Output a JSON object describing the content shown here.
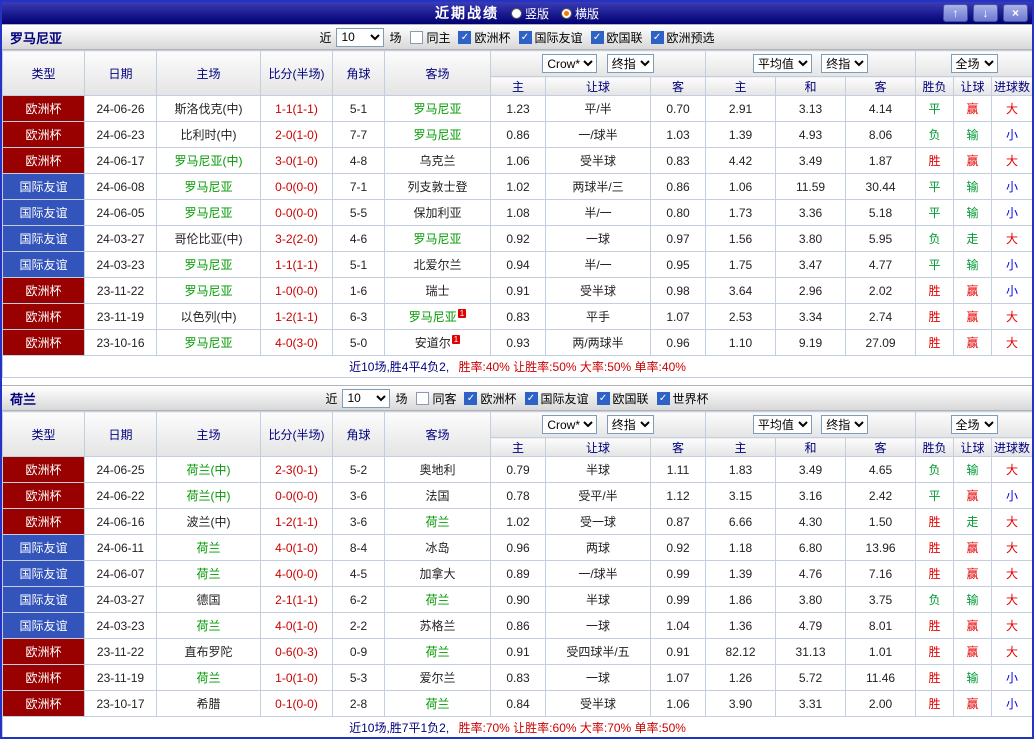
{
  "titlebar": {
    "title": "近期战绩",
    "options": [
      {
        "label": "竖版",
        "selected": false
      },
      {
        "label": "横版",
        "selected": true
      }
    ],
    "buttons": {
      "up": "↑",
      "down": "↓",
      "close": "×"
    }
  },
  "ui": {
    "recent_prefix": "近",
    "recent_suffix": "场",
    "cols": [
      "类型",
      "日期",
      "主场",
      "比分(半场)",
      "角球",
      "客场"
    ],
    "sub": [
      "主",
      "让球",
      "客",
      "主",
      "和",
      "客",
      "胜负",
      "让球",
      "进球数"
    ],
    "dd": {
      "source": "Crow*",
      "period": "终指",
      "average": "平均值",
      "period2": "终指",
      "scope": "全场"
    }
  },
  "palette": {
    "css": {
      "frame": "#2334c4",
      "tb1": "#3b3bb5",
      "tb2": "#000072",
      "navy": "#00007d",
      "line": "#c3cfe1",
      "headbg1": "#fcfcfc",
      "headbg2": "#e4e4e4",
      "barbg1": "#ffffff",
      "barbg2": "#d8d8d8",
      "btn1": "#a9b3ea",
      "btn2": "#6b79d2",
      "radio_dot": "#ff7700",
      "check": "#2f62c6",
      "score": "#cc0000"
    },
    "type_colors": {
      "欧洲杯": "#990000",
      "国际友谊": "#3355bb"
    },
    "focus_team": "#009900",
    "score": "#cc0000",
    "result": {
      "r": "#e60000",
      "g": "#009933",
      "b": "#0000ee"
    }
  },
  "sections": [
    {
      "team": "罗马尼亚",
      "filter": {
        "count": "10",
        "checkboxes": [
          {
            "label": "同主",
            "checked": false
          },
          {
            "label": "欧洲杯",
            "checked": true
          },
          {
            "label": "国际友谊",
            "checked": true
          },
          {
            "label": "欧国联",
            "checked": true
          },
          {
            "label": "欧洲预选",
            "checked": true
          }
        ]
      },
      "rows": [
        {
          "type": "欧洲杯",
          "date": "24-06-26",
          "home": {
            "n": "斯洛伐克(中)",
            "f": false
          },
          "score": "1-1(1-1)",
          "cor": "5-1",
          "away": {
            "n": "罗马尼亚",
            "f": true
          },
          "odds": [
            "1.23",
            "平/半",
            "0.70",
            "2.91",
            "3.13",
            "4.14"
          ],
          "res": [
            [
              "平",
              "g"
            ],
            [
              "赢",
              "r"
            ],
            [
              "大",
              "r"
            ]
          ]
        },
        {
          "type": "欧洲杯",
          "date": "24-06-23",
          "home": {
            "n": "比利时(中)",
            "f": false
          },
          "score": "2-0(1-0)",
          "cor": "7-7",
          "away": {
            "n": "罗马尼亚",
            "f": true
          },
          "odds": [
            "0.86",
            "一/球半",
            "1.03",
            "1.39",
            "4.93",
            "8.06"
          ],
          "res": [
            [
              "负",
              "g"
            ],
            [
              "输",
              "g"
            ],
            [
              "小",
              "b"
            ]
          ]
        },
        {
          "type": "欧洲杯",
          "date": "24-06-17",
          "home": {
            "n": "罗马尼亚(中)",
            "f": true
          },
          "score": "3-0(1-0)",
          "cor": "4-8",
          "away": {
            "n": "乌克兰",
            "f": false
          },
          "odds": [
            "1.06",
            "受半球",
            "0.83",
            "4.42",
            "3.49",
            "1.87"
          ],
          "res": [
            [
              "胜",
              "r"
            ],
            [
              "赢",
              "r"
            ],
            [
              "大",
              "r"
            ]
          ]
        },
        {
          "type": "国际友谊",
          "date": "24-06-08",
          "home": {
            "n": "罗马尼亚",
            "f": true
          },
          "score": "0-0(0-0)",
          "cor": "7-1",
          "away": {
            "n": "列支敦士登",
            "f": false
          },
          "odds": [
            "1.02",
            "两球半/三",
            "0.86",
            "1.06",
            "11.59",
            "30.44"
          ],
          "res": [
            [
              "平",
              "g"
            ],
            [
              "输",
              "g"
            ],
            [
              "小",
              "b"
            ]
          ]
        },
        {
          "type": "国际友谊",
          "date": "24-06-05",
          "home": {
            "n": "罗马尼亚",
            "f": true
          },
          "score": "0-0(0-0)",
          "cor": "5-5",
          "away": {
            "n": "保加利亚",
            "f": false
          },
          "odds": [
            "1.08",
            "半/一",
            "0.80",
            "1.73",
            "3.36",
            "5.18"
          ],
          "res": [
            [
              "平",
              "g"
            ],
            [
              "输",
              "g"
            ],
            [
              "小",
              "b"
            ]
          ]
        },
        {
          "type": "国际友谊",
          "date": "24-03-27",
          "home": {
            "n": "哥伦比亚(中)",
            "f": false
          },
          "score": "3-2(2-0)",
          "cor": "4-6",
          "away": {
            "n": "罗马尼亚",
            "f": true
          },
          "odds": [
            "0.92",
            "一球",
            "0.97",
            "1.56",
            "3.80",
            "5.95"
          ],
          "res": [
            [
              "负",
              "g"
            ],
            [
              "走",
              "g"
            ],
            [
              "大",
              "r"
            ]
          ]
        },
        {
          "type": "国际友谊",
          "date": "24-03-23",
          "home": {
            "n": "罗马尼亚",
            "f": true
          },
          "score": "1-1(1-1)",
          "cor": "5-1",
          "away": {
            "n": "北爱尔兰",
            "f": false
          },
          "odds": [
            "0.94",
            "半/一",
            "0.95",
            "1.75",
            "3.47",
            "4.77"
          ],
          "res": [
            [
              "平",
              "g"
            ],
            [
              "输",
              "g"
            ],
            [
              "小",
              "b"
            ]
          ]
        },
        {
          "type": "欧洲杯",
          "date": "23-11-22",
          "home": {
            "n": "罗马尼亚",
            "f": true
          },
          "score": "1-0(0-0)",
          "cor": "1-6",
          "away": {
            "n": "瑞士",
            "f": false
          },
          "odds": [
            "0.91",
            "受半球",
            "0.98",
            "3.64",
            "2.96",
            "2.02"
          ],
          "res": [
            [
              "胜",
              "r"
            ],
            [
              "赢",
              "r"
            ],
            [
              "小",
              "b"
            ]
          ]
        },
        {
          "type": "欧洲杯",
          "date": "23-11-19",
          "home": {
            "n": "以色列(中)",
            "f": false
          },
          "score": "1-2(1-1)",
          "cor": "6-3",
          "away": {
            "n": "罗马尼亚",
            "f": true,
            "b": "1"
          },
          "odds": [
            "0.83",
            "平手",
            "1.07",
            "2.53",
            "3.34",
            "2.74"
          ],
          "res": [
            [
              "胜",
              "r"
            ],
            [
              "赢",
              "r"
            ],
            [
              "大",
              "r"
            ]
          ]
        },
        {
          "type": "欧洲杯",
          "date": "23-10-16",
          "home": {
            "n": "罗马尼亚",
            "f": true
          },
          "score": "4-0(3-0)",
          "cor": "5-0",
          "away": {
            "n": "安道尔",
            "f": false,
            "b": "1"
          },
          "odds": [
            "0.93",
            "两/两球半",
            "0.96",
            "1.10",
            "9.19",
            "27.09"
          ],
          "res": [
            [
              "胜",
              "r"
            ],
            [
              "赢",
              "r"
            ],
            [
              "大",
              "r"
            ]
          ]
        }
      ],
      "summary": {
        "prefix": "近10场,胜4平4负2,",
        "stats": "胜率:40% 让胜率:50% 大率:50% 单率:40%"
      }
    },
    {
      "team": "荷兰",
      "filter": {
        "count": "10",
        "checkboxes": [
          {
            "label": "同客",
            "checked": false
          },
          {
            "label": "欧洲杯",
            "checked": true
          },
          {
            "label": "国际友谊",
            "checked": true
          },
          {
            "label": "欧国联",
            "checked": true
          },
          {
            "label": "世界杯",
            "checked": true
          }
        ]
      },
      "rows": [
        {
          "type": "欧洲杯",
          "date": "24-06-25",
          "home": {
            "n": "荷兰(中)",
            "f": true
          },
          "score": "2-3(0-1)",
          "cor": "5-2",
          "away": {
            "n": "奥地利",
            "f": false
          },
          "odds": [
            "0.79",
            "半球",
            "1.11",
            "1.83",
            "3.49",
            "4.65"
          ],
          "res": [
            [
              "负",
              "g"
            ],
            [
              "输",
              "g"
            ],
            [
              "大",
              "r"
            ]
          ]
        },
        {
          "type": "欧洲杯",
          "date": "24-06-22",
          "home": {
            "n": "荷兰(中)",
            "f": true
          },
          "score": "0-0(0-0)",
          "cor": "3-6",
          "away": {
            "n": "法国",
            "f": false
          },
          "odds": [
            "0.78",
            "受平/半",
            "1.12",
            "3.15",
            "3.16",
            "2.42"
          ],
          "res": [
            [
              "平",
              "g"
            ],
            [
              "赢",
              "r"
            ],
            [
              "小",
              "b"
            ]
          ]
        },
        {
          "type": "欧洲杯",
          "date": "24-06-16",
          "home": {
            "n": "波兰(中)",
            "f": false
          },
          "score": "1-2(1-1)",
          "cor": "3-6",
          "away": {
            "n": "荷兰",
            "f": true
          },
          "odds": [
            "1.02",
            "受一球",
            "0.87",
            "6.66",
            "4.30",
            "1.50"
          ],
          "res": [
            [
              "胜",
              "r"
            ],
            [
              "走",
              "g"
            ],
            [
              "大",
              "r"
            ]
          ]
        },
        {
          "type": "国际友谊",
          "date": "24-06-11",
          "home": {
            "n": "荷兰",
            "f": true
          },
          "score": "4-0(1-0)",
          "cor": "8-4",
          "away": {
            "n": "冰岛",
            "f": false
          },
          "odds": [
            "0.96",
            "两球",
            "0.92",
            "1.18",
            "6.80",
            "13.96"
          ],
          "res": [
            [
              "胜",
              "r"
            ],
            [
              "赢",
              "r"
            ],
            [
              "大",
              "r"
            ]
          ]
        },
        {
          "type": "国际友谊",
          "date": "24-06-07",
          "home": {
            "n": "荷兰",
            "f": true
          },
          "score": "4-0(0-0)",
          "cor": "4-5",
          "away": {
            "n": "加拿大",
            "f": false
          },
          "odds": [
            "0.89",
            "一/球半",
            "0.99",
            "1.39",
            "4.76",
            "7.16"
          ],
          "res": [
            [
              "胜",
              "r"
            ],
            [
              "赢",
              "r"
            ],
            [
              "大",
              "r"
            ]
          ]
        },
        {
          "type": "国际友谊",
          "date": "24-03-27",
          "home": {
            "n": "德国",
            "f": false
          },
          "score": "2-1(1-1)",
          "cor": "6-2",
          "away": {
            "n": "荷兰",
            "f": true
          },
          "odds": [
            "0.90",
            "半球",
            "0.99",
            "1.86",
            "3.80",
            "3.75"
          ],
          "res": [
            [
              "负",
              "g"
            ],
            [
              "输",
              "g"
            ],
            [
              "大",
              "r"
            ]
          ]
        },
        {
          "type": "国际友谊",
          "date": "24-03-23",
          "home": {
            "n": "荷兰",
            "f": true
          },
          "score": "4-0(1-0)",
          "cor": "2-2",
          "away": {
            "n": "苏格兰",
            "f": false
          },
          "odds": [
            "0.86",
            "一球",
            "1.04",
            "1.36",
            "4.79",
            "8.01"
          ],
          "res": [
            [
              "胜",
              "r"
            ],
            [
              "赢",
              "r"
            ],
            [
              "大",
              "r"
            ]
          ]
        },
        {
          "type": "欧洲杯",
          "date": "23-11-22",
          "home": {
            "n": "直布罗陀",
            "f": false
          },
          "score": "0-6(0-3)",
          "cor": "0-9",
          "away": {
            "n": "荷兰",
            "f": true
          },
          "odds": [
            "0.91",
            "受四球半/五",
            "0.91",
            "82.12",
            "31.13",
            "1.01"
          ],
          "res": [
            [
              "胜",
              "r"
            ],
            [
              "赢",
              "r"
            ],
            [
              "大",
              "r"
            ]
          ]
        },
        {
          "type": "欧洲杯",
          "date": "23-11-19",
          "home": {
            "n": "荷兰",
            "f": true
          },
          "score": "1-0(1-0)",
          "cor": "5-3",
          "away": {
            "n": "爱尔兰",
            "f": false
          },
          "odds": [
            "0.83",
            "一球",
            "1.07",
            "1.26",
            "5.72",
            "11.46"
          ],
          "res": [
            [
              "胜",
              "r"
            ],
            [
              "输",
              "g"
            ],
            [
              "小",
              "b"
            ]
          ]
        },
        {
          "type": "欧洲杯",
          "date": "23-10-17",
          "home": {
            "n": "希腊",
            "f": false
          },
          "score": "0-1(0-0)",
          "cor": "2-8",
          "away": {
            "n": "荷兰",
            "f": true
          },
          "odds": [
            "0.84",
            "受半球",
            "1.06",
            "3.90",
            "3.31",
            "2.00"
          ],
          "res": [
            [
              "胜",
              "r"
            ],
            [
              "赢",
              "r"
            ],
            [
              "小",
              "b"
            ]
          ]
        }
      ],
      "summary": {
        "prefix": "近10场,胜7平1负2,",
        "stats": "胜率:70% 让胜率:60% 大率:70% 单率:50%"
      }
    }
  ]
}
